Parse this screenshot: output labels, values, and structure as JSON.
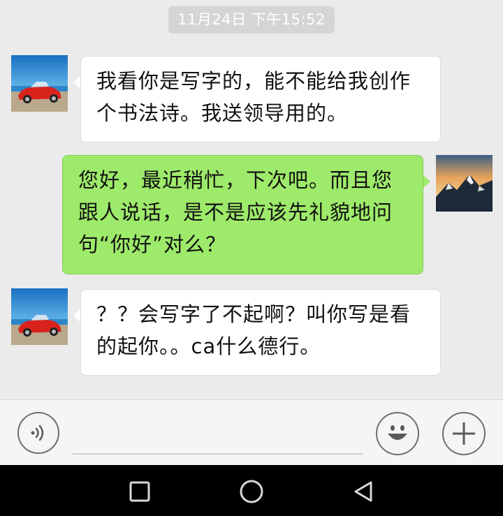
{
  "timestamp": "11月24日 下午15:52",
  "messages": [
    {
      "side": "in",
      "lines": [
        "我看你是写字的，能不能给我创作",
        "个书法诗。我送领导用的。"
      ]
    },
    {
      "side": "out",
      "lines": [
        "您好，最近稍忙，下次吧。而且您",
        "跟人说话，是不是应该先礼貌地问",
        "句“你好”对么？"
      ]
    },
    {
      "side": "in",
      "lines": [
        "？？会写字了不起啊？叫你写是看",
        "的起你。。ca什么德行。"
      ]
    }
  ],
  "icons": {
    "voice": "voice-icon",
    "emoji": "emoji-icon",
    "add": "plus-icon",
    "nav_recent": "square-icon",
    "nav_home": "circle-icon",
    "nav_back": "triangle-back-icon"
  },
  "colors": {
    "background": "#ebebeb",
    "incoming_bubble": "#ffffff",
    "outgoing_bubble": "#9eea6a",
    "nav_bar": "#000000"
  }
}
